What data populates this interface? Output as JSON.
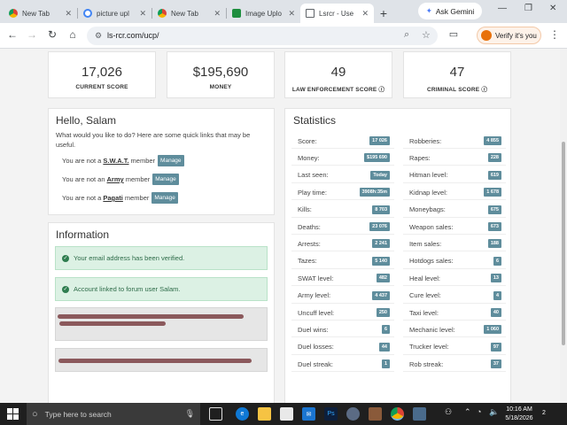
{
  "browser": {
    "tabs": [
      {
        "title": "New Tab",
        "icon": "chrome-icon",
        "active": false
      },
      {
        "title": "picture upl",
        "icon": "google-icon",
        "active": false
      },
      {
        "title": "New Tab",
        "icon": "chrome-icon",
        "active": false
      },
      {
        "title": "Image Uplo",
        "icon": "image-icon",
        "active": false
      },
      {
        "title": "Lsrcr - Use",
        "icon": "document-icon",
        "active": true
      }
    ],
    "gemini_label": "Ask Gemini",
    "url": "ls-rcr.com/ucp/",
    "verify_label": "Verify it's you"
  },
  "top_stats": [
    {
      "value": "17,026",
      "label": "CURRENT SCORE"
    },
    {
      "value": "$195,690",
      "label": "MONEY"
    },
    {
      "value": "49",
      "label": "LAW ENFORCEMENT SCORE ⓘ"
    },
    {
      "value": "47",
      "label": "CRIMINAL SCORE ⓘ"
    }
  ],
  "hello": {
    "title": "Hello, Salam",
    "intro": "What would you like to do? Here are some quick links that may be useful.",
    "memberships": [
      {
        "prefix": "You are not a",
        "group": "S.W.A.T.",
        "suffix": "member",
        "button": "Manage"
      },
      {
        "prefix": "You are not an",
        "group": "Army",
        "suffix": "member",
        "button": "Manage"
      },
      {
        "prefix": "You are not a",
        "group": "Pagati",
        "suffix": "member",
        "button": "Manage"
      }
    ]
  },
  "information": {
    "title": "Information",
    "alerts": [
      "Your email address has been verified.",
      "Account linked to forum user Salam."
    ]
  },
  "statistics": {
    "title": "Statistics",
    "left": [
      {
        "label": "Score:",
        "value": "17 026"
      },
      {
        "label": "Money:",
        "value": "$195 690"
      },
      {
        "label": "Last seen:",
        "value": "Today"
      },
      {
        "label": "Play time:",
        "value": "3908h:35m"
      },
      {
        "label": "Kills:",
        "value": "8 703"
      },
      {
        "label": "Deaths:",
        "value": "23 076"
      },
      {
        "label": "Arrests:",
        "value": "2 241"
      },
      {
        "label": "Tazes:",
        "value": "5 140"
      },
      {
        "label": "SWAT level:",
        "value": "482"
      },
      {
        "label": "Army level:",
        "value": "4 437"
      },
      {
        "label": "Uncuff level:",
        "value": "250"
      },
      {
        "label": "Duel wins:",
        "value": "6"
      },
      {
        "label": "Duel losses:",
        "value": "44"
      },
      {
        "label": "Duel streak:",
        "value": "1"
      }
    ],
    "right": [
      {
        "label": "Robberies:",
        "value": "4 855"
      },
      {
        "label": "Rapes:",
        "value": "228"
      },
      {
        "label": "Hitman level:",
        "value": "619"
      },
      {
        "label": "Kidnap level:",
        "value": "1 678"
      },
      {
        "label": "Moneybags:",
        "value": "675"
      },
      {
        "label": "Weapon sales:",
        "value": "673"
      },
      {
        "label": "Item sales:",
        "value": "188"
      },
      {
        "label": "Hotdogs sales:",
        "value": "6"
      },
      {
        "label": "Heal level:",
        "value": "13"
      },
      {
        "label": "Cure level:",
        "value": "4"
      },
      {
        "label": "Taxi level:",
        "value": "40"
      },
      {
        "label": "Mechanic level:",
        "value": "1 060"
      },
      {
        "label": "Trucker level:",
        "value": "97"
      },
      {
        "label": "Rob streak:",
        "value": "37"
      }
    ]
  },
  "taskbar": {
    "search_placeholder": "Type here to search",
    "time": "10:16 AM",
    "date": "5/18/2026",
    "notifications": "2"
  },
  "colors": {
    "badge": "#5f8d9c",
    "alert_bg": "#dcf1e4",
    "alert_text": "#2d6b48"
  }
}
